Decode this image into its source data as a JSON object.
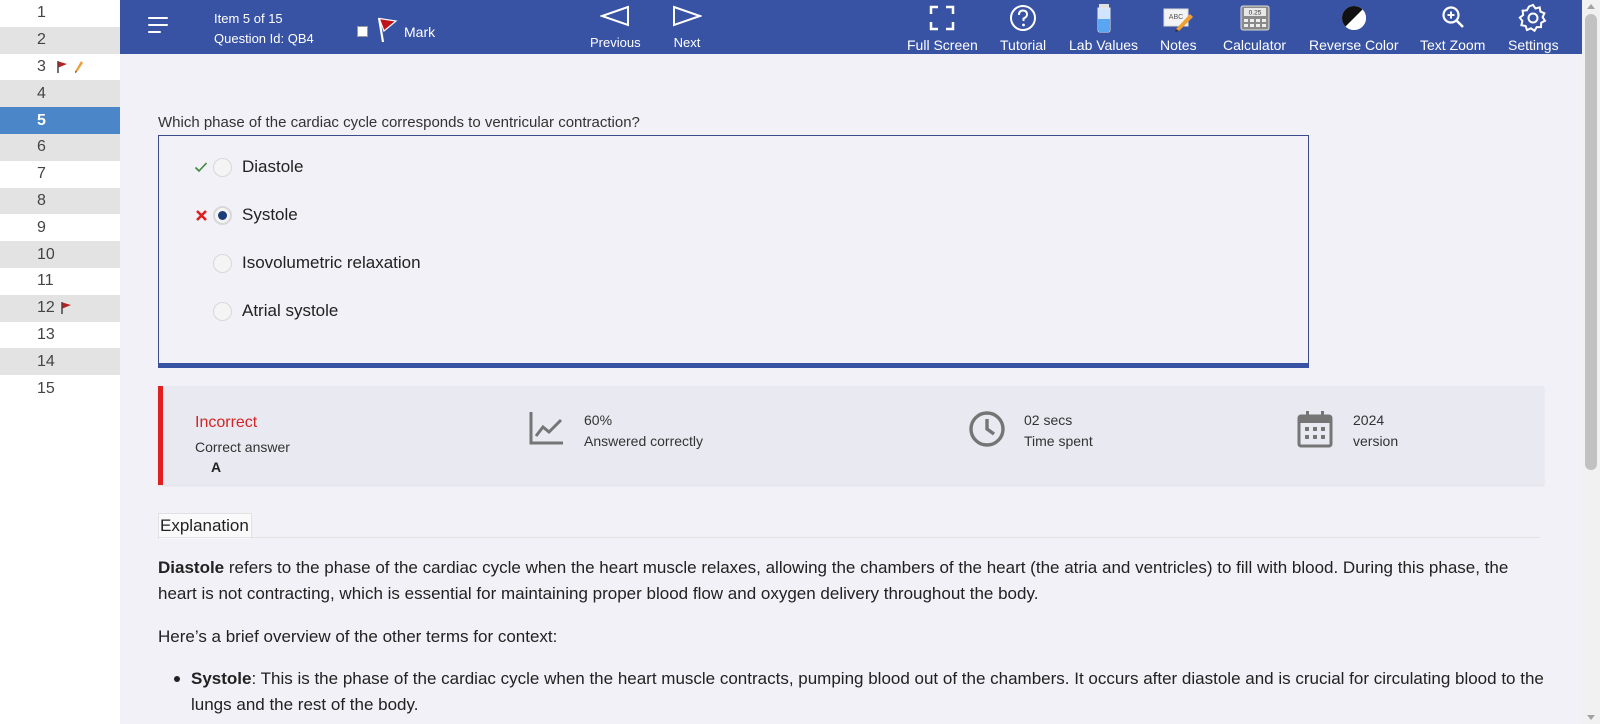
{
  "sidebar": {
    "items": [
      {
        "label": "1"
      },
      {
        "label": "2"
      },
      {
        "label": "3"
      },
      {
        "label": "4"
      },
      {
        "label": "5"
      },
      {
        "label": "6"
      },
      {
        "label": "7"
      },
      {
        "label": "8"
      },
      {
        "label": "9"
      },
      {
        "label": "10"
      },
      {
        "label": "11"
      },
      {
        "label": "12"
      },
      {
        "label": "13"
      },
      {
        "label": "14"
      },
      {
        "label": "15"
      }
    ]
  },
  "header": {
    "item_position": "Item 5 of 15",
    "question_id": "Question Id: QB4",
    "mark_label": "Mark",
    "previous_label": "Previous",
    "next_label": "Next",
    "tools": {
      "full_screen": "Full Screen",
      "tutorial": "Tutorial",
      "lab_values": "Lab Values",
      "notes": "Notes",
      "calculator": "Calculator",
      "reverse_color": "Reverse Color",
      "text_zoom": "Text Zoom",
      "settings": "Settings"
    },
    "notes_icon_text": "ABC",
    "calculator_icon_text": "0.25"
  },
  "question": {
    "text": "Which phase of the cardiac cycle corresponds to ventricular contraction?",
    "answers": [
      {
        "label": "Diastole",
        "result": "correct"
      },
      {
        "label": "Systole",
        "result": "incorrect-selected"
      },
      {
        "label": "Isovolumetric relaxation",
        "result": ""
      },
      {
        "label": "Atrial systole",
        "result": ""
      }
    ]
  },
  "result": {
    "status": "Incorrect",
    "correct_answer_label": "Correct answer",
    "correct_answer": "A",
    "percent": "60%",
    "percent_label": "Answered correctly",
    "time": "02 secs",
    "time_label": "Time spent",
    "version_year": "2024",
    "version_label": "version"
  },
  "explanation": {
    "title": "Explanation",
    "p1_term": "Diastole",
    "p1_text": " refers to the phase of the cardiac cycle when the heart muscle relaxes, allowing the chambers of the heart (the atria and ventricles) to fill with blood. During this phase, the heart is not contracting, which is essential for maintaining proper blood flow and oxygen delivery throughout the body.",
    "p2_text": "Here’s a brief overview of the other terms for context:",
    "bullet1_term": "Systole",
    "bullet1_text": ": This is the phase of the cardiac cycle when the heart muscle contracts, pumping blood out of the chambers. It occurs after diastole and is crucial for circulating blood to the lungs and the rest of the body."
  },
  "colors": {
    "header_bg": "#3852a4",
    "current_item": "#4a86c8",
    "incorrect": "#e02020",
    "correct_check": "#3a8a3a"
  }
}
